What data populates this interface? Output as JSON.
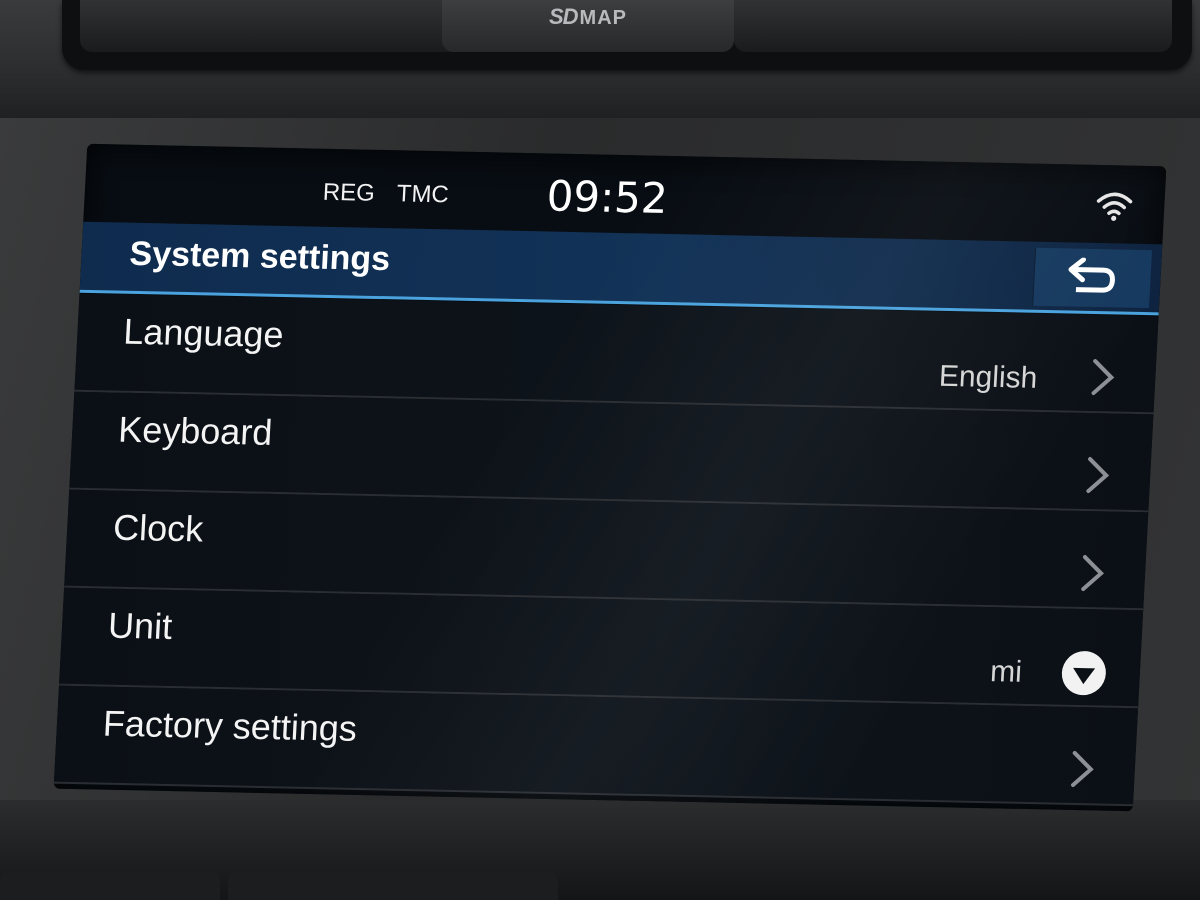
{
  "hardware": {
    "sd_brand": "SD",
    "map_label": "MAP"
  },
  "status_bar": {
    "indicator_reg": "REG",
    "indicator_tmc": "TMC",
    "time": "09:52",
    "wifi_icon": "wifi-icon"
  },
  "header": {
    "title": "System settings",
    "back_icon": "back-arrow-icon"
  },
  "settings": {
    "items": [
      {
        "label": "Language",
        "value": "English",
        "control": "chevron-right-icon"
      },
      {
        "label": "Keyboard",
        "value": "",
        "control": "chevron-right-icon"
      },
      {
        "label": "Clock",
        "value": "",
        "control": "chevron-right-icon"
      },
      {
        "label": "Unit",
        "value": "mi",
        "control": "dropdown-icon"
      },
      {
        "label": "Factory settings",
        "value": "",
        "control": "chevron-right-icon"
      }
    ]
  },
  "colors": {
    "header_bg": "#123257",
    "header_accent": "#4aa3de",
    "screen_bg": "#080d13",
    "text": "#f4f4f4"
  }
}
